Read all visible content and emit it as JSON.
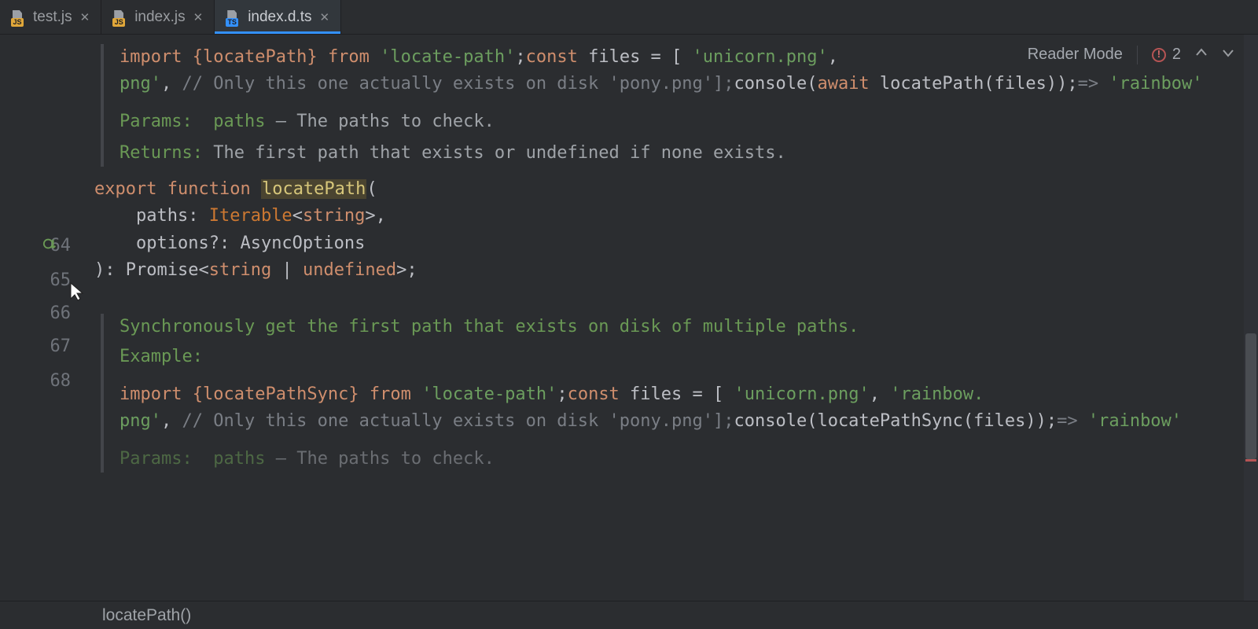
{
  "tabs": [
    {
      "label": "test.js",
      "icon": "js",
      "active": false
    },
    {
      "label": "index.js",
      "icon": "js",
      "active": false
    },
    {
      "label": "index.d.ts",
      "icon": "ts",
      "active": true
    }
  ],
  "reader_mode_label": "Reader Mode",
  "error_count": "2",
  "gutter_lines": {
    "l64": "64",
    "l65": "65",
    "l66": "66",
    "l67": "67",
    "l68": "68"
  },
  "doc1": {
    "tok_import": "import",
    "tok_braces": "{locatePath}",
    "tok_from": "from",
    "tok_pkg": "'locate-path'",
    "tok_semi1": ";",
    "tok_const": "const",
    "tok_files_eq": " files = [ ",
    "tok_str_unicorn": "'unicorn.png'",
    "tok_comma1": ",",
    "tok_line2a": "png'",
    "tok_comma2": ",",
    "tok_comment": " // Only this one actually exists on disk 'pony.png'];",
    "tok_console": "console",
    "tok_paren_open": "(",
    "tok_await": "await",
    "tok_call": " locatePath(files));",
    "tok_arrow": "=>",
    "tok_rainbow": " 'rainbow'",
    "params_label": "Params:",
    "params_name": "paths",
    "params_dash": " – ",
    "params_desc": "The paths to check.",
    "returns_label": "Returns:",
    "returns_desc": "The first path that exists or undefined if none exists."
  },
  "sig": {
    "kw_export": "export",
    "kw_function": "function",
    "fn_name": "locatePath",
    "open": "(",
    "p1_name": "paths",
    "p1_colon": ": ",
    "p1_type_iter": "Iterable",
    "p1_lt": "<",
    "p1_type_str": "string",
    "p1_gt": ">",
    "p1_comma": ",",
    "p2_name": "options",
    "p2_opt": "?",
    "p2_colon": ": ",
    "p2_type": "AsyncOptions",
    "close": "): ",
    "ret_promise": "Promise",
    "ret_lt": "<",
    "ret_str": "string",
    "ret_pipe": " | ",
    "ret_undef": "undefined",
    "ret_gt": ">",
    "semi": ";"
  },
  "doc2": {
    "summary": "Synchronously get the first path that exists on disk of multiple paths.",
    "example_label": "Example:",
    "tok_import": "import",
    "tok_braces": "{locatePathSync}",
    "tok_from": "from",
    "tok_pkg": "'locate-path'",
    "tok_semi1": ";",
    "tok_const": "const",
    "tok_files_eq": " files = [ ",
    "tok_str_unicorn": "'unicorn.png'",
    "tok_comma1": ",",
    "tok_str_rainbow_frag": " 'rainbow.",
    "tok_line2a": "png'",
    "tok_comma2": ",",
    "tok_comment": " // Only this one actually exists on disk 'pony.png'];",
    "tok_console": "console",
    "tok_call": "(locatePathSync(files));",
    "tok_arrow": "=>",
    "tok_rainbow": " 'rainbow'",
    "params_label": "Params:",
    "params_name": "paths",
    "params_dash": " – ",
    "params_desc": "The paths to check."
  },
  "breadcrumb": "locatePath()"
}
